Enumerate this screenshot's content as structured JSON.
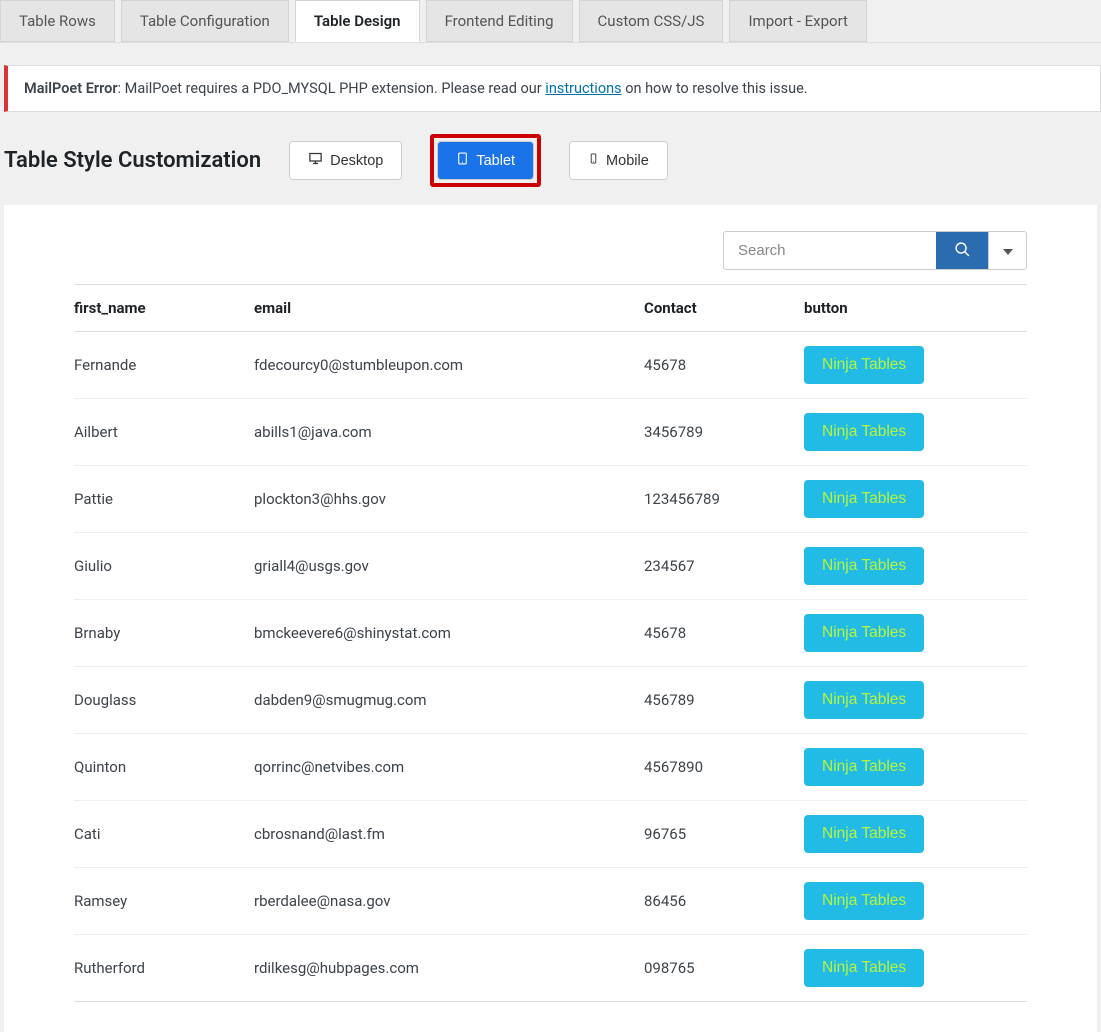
{
  "tabs": [
    {
      "label": "Table Rows",
      "active": false
    },
    {
      "label": "Table Configuration",
      "active": false
    },
    {
      "label": "Table Design",
      "active": true
    },
    {
      "label": "Frontend Editing",
      "active": false
    },
    {
      "label": "Custom CSS/JS",
      "active": false
    },
    {
      "label": "Import - Export",
      "active": false
    }
  ],
  "alert": {
    "prefix": "MailPoet Error",
    "text_before": ": MailPoet requires a PDO_MYSQL PHP extension. Please read our ",
    "link_text": "instructions",
    "text_after": " on how to resolve this issue."
  },
  "title": "Table Style Customization",
  "devices": {
    "desktop": "Desktop",
    "tablet": "Tablet",
    "mobile": "Mobile"
  },
  "search": {
    "placeholder": "Search"
  },
  "columns": {
    "first_name": "first_name",
    "email": "email",
    "contact": "Contact",
    "button": "button"
  },
  "button_label": "Ninja Tables",
  "rows": [
    {
      "first_name": "Fernande",
      "email": "fdecourcy0@stumbleupon.com",
      "contact": "45678"
    },
    {
      "first_name": "Ailbert",
      "email": "abills1@java.com",
      "contact": "3456789"
    },
    {
      "first_name": "Pattie",
      "email": "plockton3@hhs.gov",
      "contact": "123456789"
    },
    {
      "first_name": "Giulio",
      "email": "griall4@usgs.gov",
      "contact": "234567"
    },
    {
      "first_name": "Brnaby",
      "email": "bmckeevere6@shinystat.com",
      "contact": "45678"
    },
    {
      "first_name": "Douglass",
      "email": "dabden9@smugmug.com",
      "contact": "456789"
    },
    {
      "first_name": "Quinton",
      "email": "qorrinc@netvibes.com",
      "contact": "4567890"
    },
    {
      "first_name": "Cati",
      "email": "cbrosnand@last.fm",
      "contact": "96765"
    },
    {
      "first_name": "Ramsey",
      "email": "rberdalee@nasa.gov",
      "contact": "86456"
    },
    {
      "first_name": "Rutherford",
      "email": "rdilkesg@hubpages.com",
      "contact": "098765"
    }
  ]
}
